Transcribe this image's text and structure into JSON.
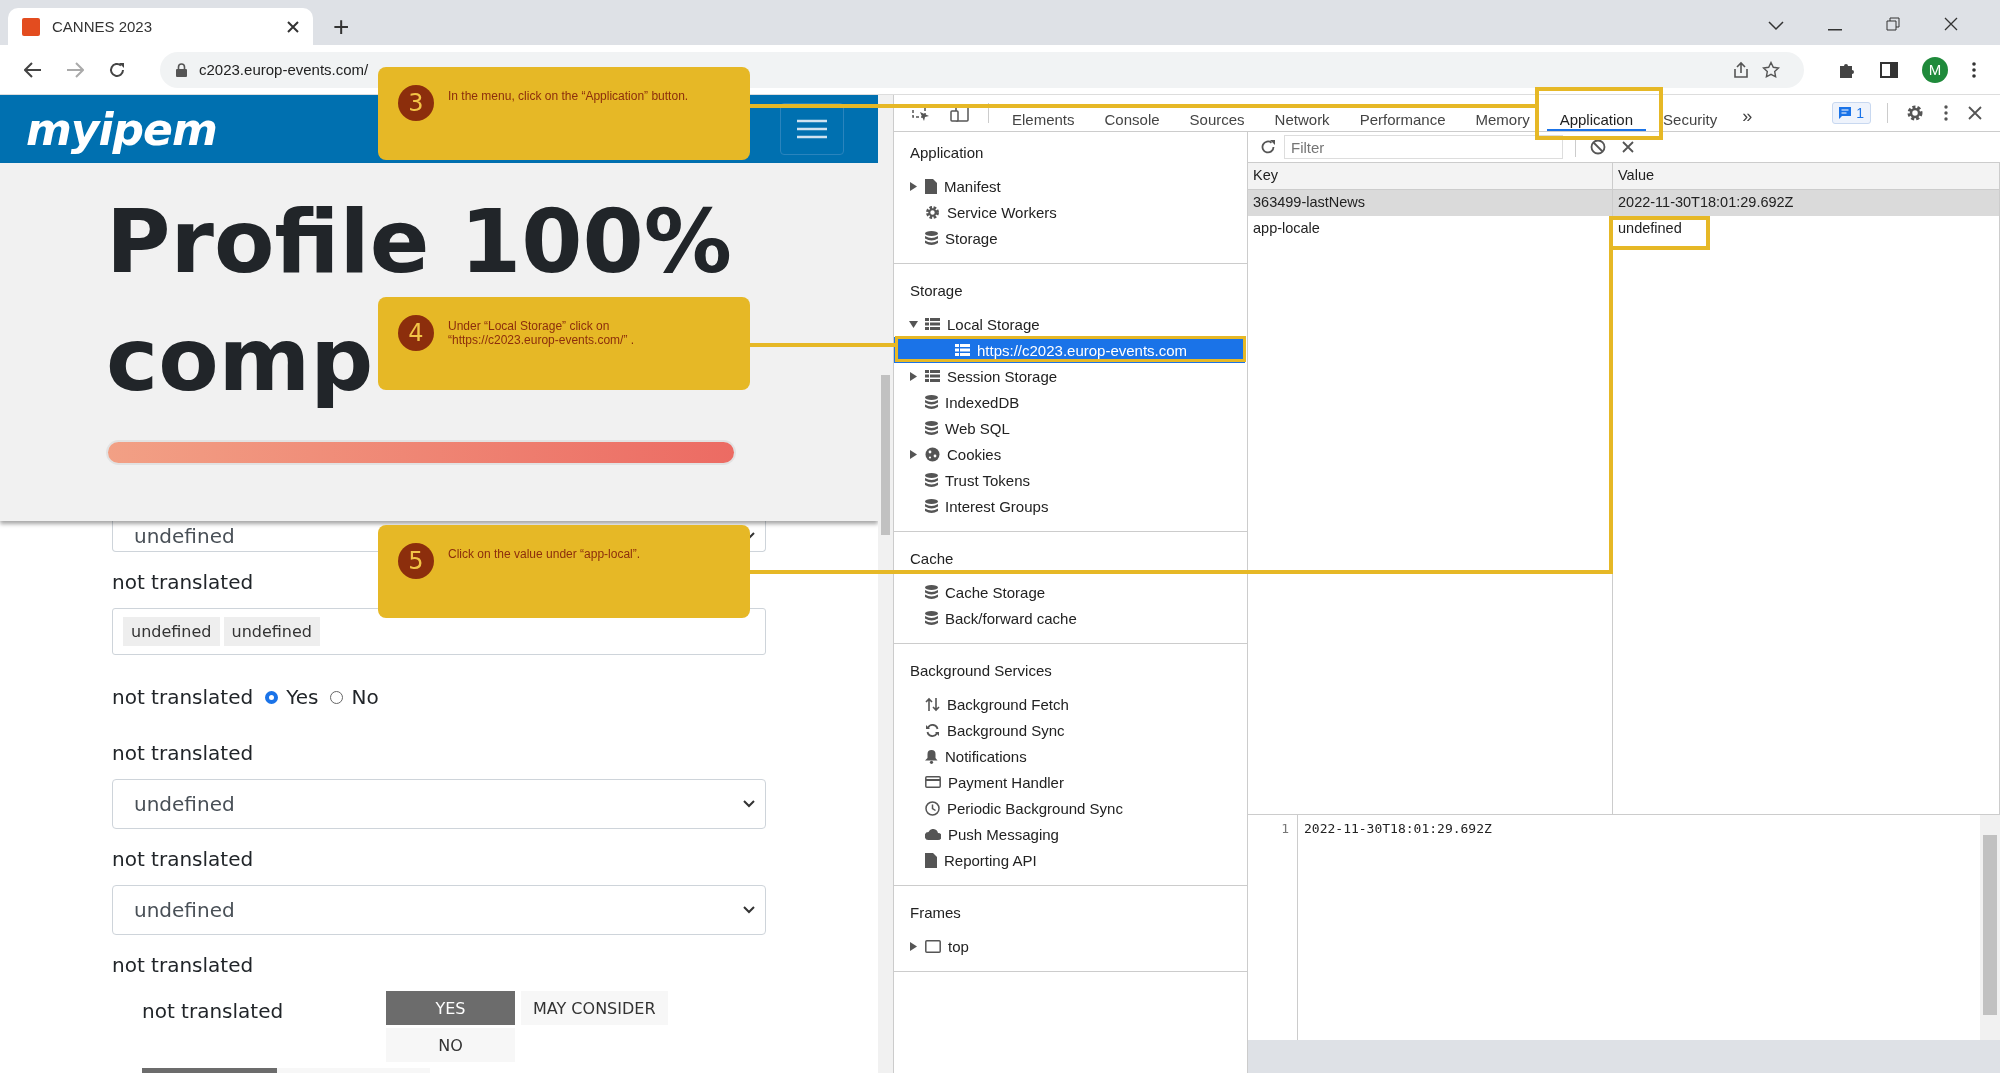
{
  "browser": {
    "tab": {
      "title": "CANNES 2023"
    },
    "new_tab": "+",
    "address": "c2023.europ-events.com/",
    "avatar": "M"
  },
  "page": {
    "logo": "myipem",
    "profile": {
      "heading_lines": [
        "Profile 100%",
        "comp"
      ],
      "level": 1
    },
    "form": [
      {
        "kind": "select",
        "value": "undefined"
      },
      {
        "kind": "label",
        "text": "not translated"
      },
      {
        "kind": "tags",
        "tags": [
          "undefined",
          "undefined"
        ]
      },
      {
        "kind": "radio",
        "label": "not translated",
        "options": [
          {
            "label": "Yes",
            "selected": true
          },
          {
            "label": "No",
            "selected": false
          }
        ]
      },
      {
        "kind": "label",
        "text": "not translated"
      },
      {
        "kind": "select",
        "value": "undefined"
      },
      {
        "kind": "label",
        "text": "not translated"
      },
      {
        "kind": "select",
        "value": "undefined"
      },
      {
        "kind": "label",
        "text": "not translated"
      },
      {
        "kind": "choice",
        "label": "not translated",
        "options": [
          {
            "label": "YES",
            "selected": true
          },
          {
            "label": "MAY CONSIDER",
            "selected": false
          },
          {
            "label": "NO",
            "selected": false
          }
        ]
      }
    ]
  },
  "devtools": {
    "tabs": [
      {
        "label": "Elements",
        "selected": false
      },
      {
        "label": "Console",
        "selected": false
      },
      {
        "label": "Sources",
        "selected": false
      },
      {
        "label": "Network",
        "selected": false
      },
      {
        "label": "Performance",
        "selected": false
      },
      {
        "label": "Memory",
        "selected": false
      },
      {
        "label": "Application",
        "selected": true
      },
      {
        "label": "Security",
        "selected": false
      }
    ],
    "more": "»",
    "issues": "1",
    "sidebar": [
      {
        "title": "Application",
        "items": [
          {
            "label": "Manifest",
            "kind": "file",
            "expanded": false,
            "selected": false
          },
          {
            "label": "Service Workers",
            "kind": "gear",
            "selected": false
          },
          {
            "label": "Storage",
            "kind": "db",
            "selected": false
          }
        ]
      },
      {
        "title": "Storage",
        "items": [
          {
            "label": "Local Storage",
            "kind": "table",
            "expanded": true,
            "selected": false,
            "children": [
              {
                "label": "https://c2023.europ-events.com",
                "kind": "table",
                "selected": true
              }
            ]
          },
          {
            "label": "Session Storage",
            "kind": "table",
            "expanded": false,
            "selected": false
          },
          {
            "label": "IndexedDB",
            "kind": "db",
            "selected": false
          },
          {
            "label": "Web SQL",
            "kind": "db",
            "selected": false
          },
          {
            "label": "Cookies",
            "kind": "cookie",
            "expanded": false,
            "selected": false
          },
          {
            "label": "Trust Tokens",
            "kind": "db",
            "selected": false
          },
          {
            "label": "Interest Groups",
            "kind": "db",
            "selected": false
          }
        ]
      },
      {
        "title": "Cache",
        "items": [
          {
            "label": "Cache Storage",
            "kind": "db",
            "selected": false
          },
          {
            "label": "Back/forward cache",
            "kind": "db",
            "selected": false
          }
        ]
      },
      {
        "title": "Background Services",
        "items": [
          {
            "label": "Background Fetch",
            "kind": "updown",
            "selected": false
          },
          {
            "label": "Background Sync",
            "kind": "sync",
            "selected": false
          },
          {
            "label": "Notifications",
            "kind": "bell",
            "selected": false
          },
          {
            "label": "Payment Handler",
            "kind": "card",
            "selected": false
          },
          {
            "label": "Periodic Background Sync",
            "kind": "clock",
            "selected": false
          },
          {
            "label": "Push Messaging",
            "kind": "cloud",
            "selected": false
          },
          {
            "label": "Reporting API",
            "kind": "file",
            "selected": false
          }
        ]
      },
      {
        "title": "Frames",
        "items": [
          {
            "label": "top",
            "kind": "frame",
            "expanded": false,
            "selected": false
          }
        ]
      }
    ],
    "storage": {
      "filter": {
        "placeholder": "Filter"
      },
      "columns": [
        "Key",
        "Value"
      ],
      "rows": [
        {
          "key": "363499-lastNews",
          "value": "2022-11-30T18:01:29.692Z",
          "selected": true
        },
        {
          "key": "app-locale",
          "value": "undefined",
          "selected": false
        }
      ],
      "preview": {
        "line_number": "1",
        "text": "2022-11-30T18:01:29.692Z"
      }
    }
  },
  "callouts": [
    {
      "number": "3",
      "lines": [
        "In the menu, click on the “Application” button."
      ]
    },
    {
      "number": "4",
      "lines": [
        "Under “Local Storage” click on",
        "“https://c2023.europ-events.com/” ."
      ]
    },
    {
      "number": "5",
      "lines": [
        "Click on the value under “app-local”."
      ]
    }
  ]
}
